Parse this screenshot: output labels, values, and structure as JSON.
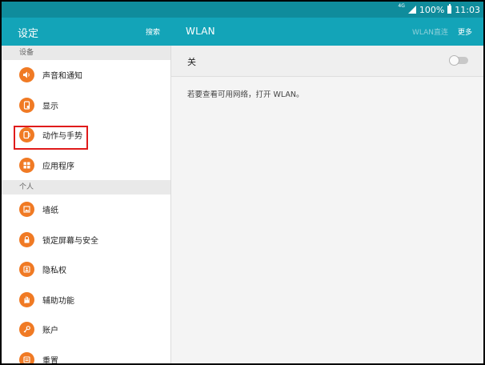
{
  "status_bar": {
    "network": "4G",
    "battery": "100%",
    "time": "11:03"
  },
  "left_header": {
    "title": "设定",
    "search_label": "搜索"
  },
  "right_header": {
    "title": "WLAN",
    "wlan_direct_label": "WLAN直连",
    "more_label": "更多"
  },
  "sidebar": {
    "sections": [
      {
        "header": "设备",
        "items": [
          {
            "label": "声音和通知",
            "icon": "speaker-icon"
          },
          {
            "label": "显示",
            "icon": "display-icon"
          },
          {
            "label": "动作与手势",
            "icon": "motion-icon"
          },
          {
            "label": "应用程序",
            "icon": "apps-grid-icon"
          }
        ]
      },
      {
        "header": "个人",
        "items": [
          {
            "label": "墙纸",
            "icon": "wallpaper-icon"
          },
          {
            "label": "锁定屏幕与安全",
            "icon": "lock-icon"
          },
          {
            "label": "隐私权",
            "icon": "privacy-icon"
          },
          {
            "label": "辅助功能",
            "icon": "hand-icon"
          },
          {
            "label": "账户",
            "icon": "key-icon"
          },
          {
            "label": "重置",
            "icon": "reset-icon"
          }
        ]
      }
    ]
  },
  "main": {
    "toggle_label": "关",
    "toggle_state": "off",
    "hint": "若要查看可用网络，打开 WLAN。"
  },
  "colors": {
    "status_bar": "#0f8c9c",
    "app_bar": "#13a4b8",
    "icon_orange": "#f07a24",
    "highlight_red": "#e01b1b"
  }
}
